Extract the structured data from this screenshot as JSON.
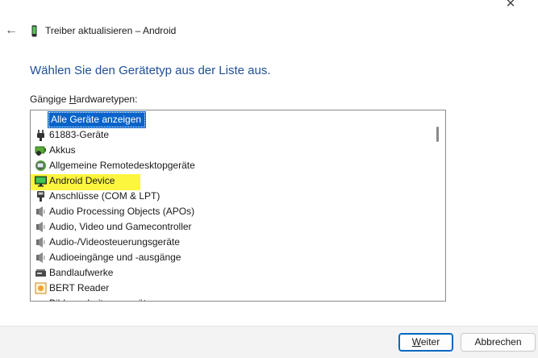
{
  "window": {
    "title": "Treiber aktualisieren – Android",
    "back_icon": "←",
    "close_icon": "✕"
  },
  "heading": "Wählen Sie den Gerätetyp aus der Liste aus.",
  "list": {
    "label_pre": "Gängige ",
    "label_accel": "H",
    "label_post": "ardwaretypen:",
    "header": "Alle Geräte anzeigen",
    "items": [
      {
        "label": "61883-Geräte",
        "icon": "plug-icon"
      },
      {
        "label": "Akkus",
        "icon": "battery-icon"
      },
      {
        "label": "Allgemeine Remotedesktopgeräte",
        "icon": "remote-desktop-icon"
      },
      {
        "label": "Android Device",
        "icon": "monitor-icon",
        "highlighted": true
      },
      {
        "label": "Anschlüsse (COM & LPT)",
        "icon": "port-icon"
      },
      {
        "label": "Audio Processing Objects (APOs)",
        "icon": "speaker-icon"
      },
      {
        "label": "Audio, Video und Gamecontroller",
        "icon": "speaker-icon"
      },
      {
        "label": "Audio-/Videosteuerungsgeräte",
        "icon": "speaker-icon"
      },
      {
        "label": "Audioeingänge und -ausgänge",
        "icon": "speaker-icon"
      },
      {
        "label": "Bandlaufwerke",
        "icon": "tape-drive-icon"
      },
      {
        "label": "BERT Reader",
        "icon": "reader-icon"
      },
      {
        "label": "Bildverarbeitungsgeräte",
        "icon": "camera-icon"
      }
    ]
  },
  "buttons": {
    "next_accel": "W",
    "next_rest": "eiter",
    "cancel": "Abbrechen"
  },
  "colors": {
    "heading": "#1f4e9a",
    "selection": "#0a63c9",
    "highlight": "#fcf63e"
  }
}
